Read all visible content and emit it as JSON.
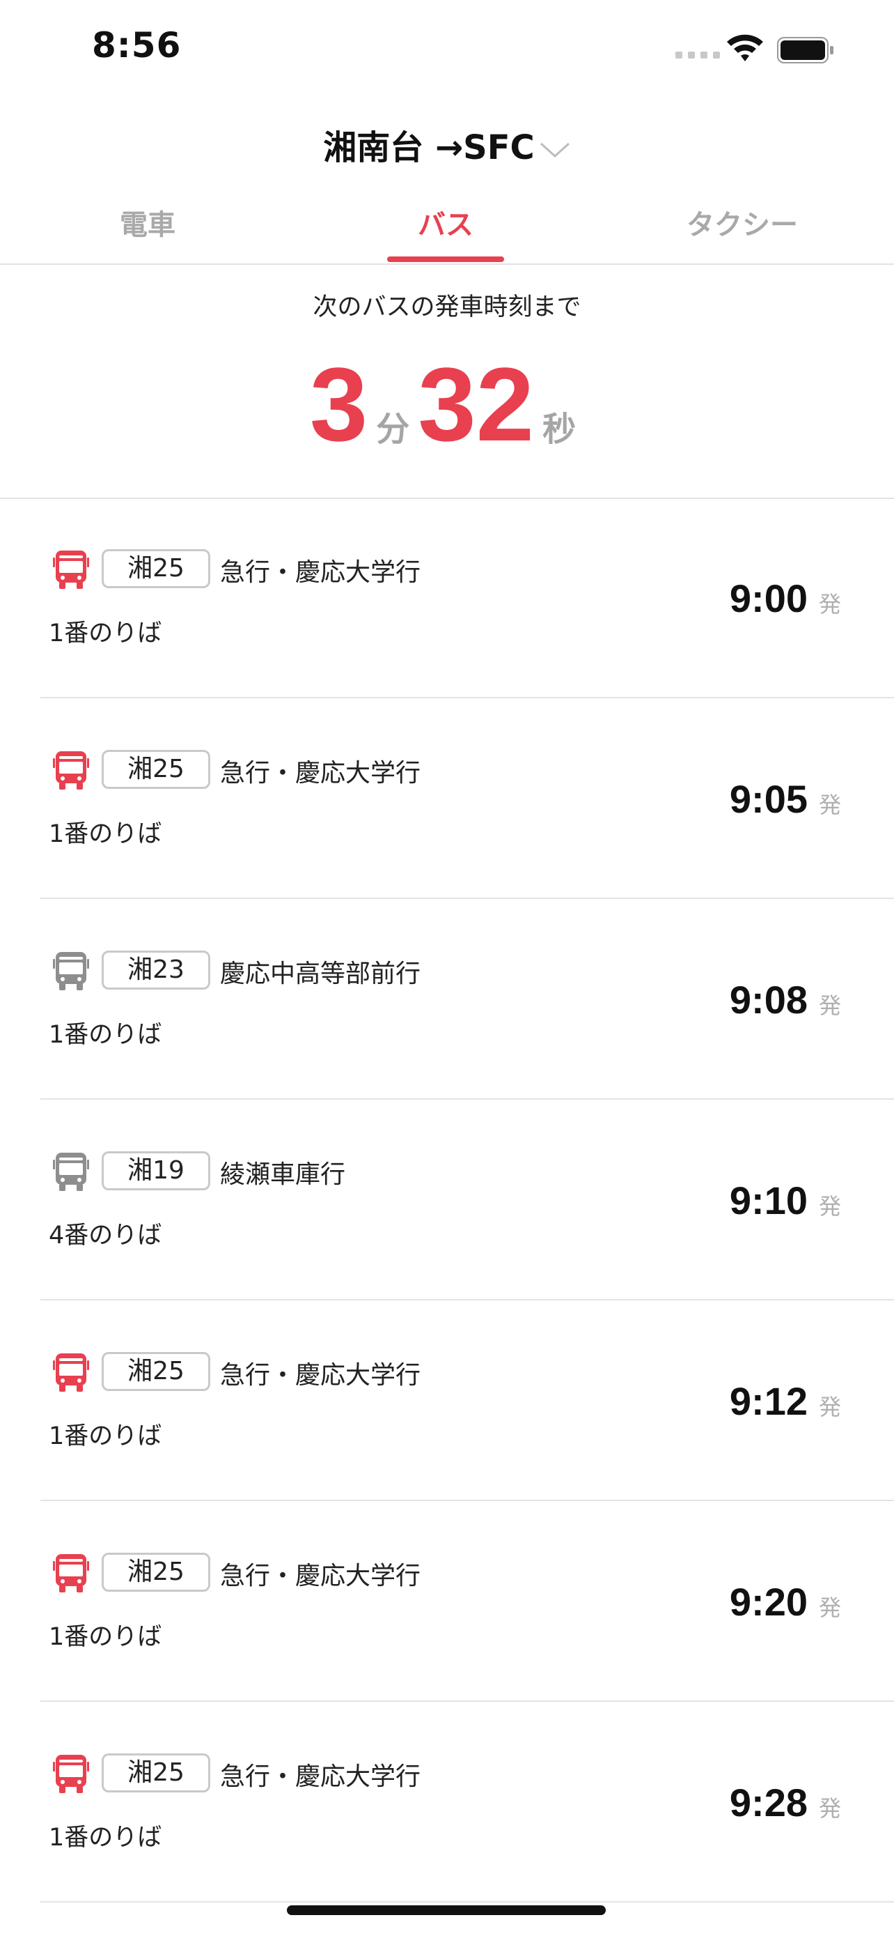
{
  "status_bar": {
    "time": "8:56"
  },
  "header": {
    "route_title": "湘南台 →SFC"
  },
  "tabs": [
    {
      "label": "電車",
      "active": false
    },
    {
      "label": "バス",
      "active": true
    },
    {
      "label": "タクシー",
      "active": false
    }
  ],
  "countdown": {
    "caption": "次のバスの発車時刻まで",
    "minutes": "3",
    "minutes_unit": "分",
    "seconds": "32",
    "seconds_unit": "秒"
  },
  "colors": {
    "accent": "#e8404f",
    "inactive_icon": "#8e8e8e"
  },
  "departures": [
    {
      "route": "湘25",
      "destination": "急行・慶応大学行",
      "platform": "1番のりば",
      "time": "9:00",
      "suffix": "発",
      "icon": "bus-icon-red"
    },
    {
      "route": "湘25",
      "destination": "急行・慶応大学行",
      "platform": "1番のりば",
      "time": "9:05",
      "suffix": "発",
      "icon": "bus-icon-red"
    },
    {
      "route": "湘23",
      "destination": "慶応中高等部前行",
      "platform": "1番のりば",
      "time": "9:08",
      "suffix": "発",
      "icon": "bus-icon-gray"
    },
    {
      "route": "湘19",
      "destination": "綾瀬車庫行",
      "platform": "4番のりば",
      "time": "9:10",
      "suffix": "発",
      "icon": "bus-icon-gray"
    },
    {
      "route": "湘25",
      "destination": "急行・慶応大学行",
      "platform": "1番のりば",
      "time": "9:12",
      "suffix": "発",
      "icon": "bus-icon-red"
    },
    {
      "route": "湘25",
      "destination": "急行・慶応大学行",
      "platform": "1番のりば",
      "time": "9:20",
      "suffix": "発",
      "icon": "bus-icon-red"
    },
    {
      "route": "湘25",
      "destination": "急行・慶応大学行",
      "platform": "1番のりば",
      "time": "9:28",
      "suffix": "発",
      "icon": "bus-icon-red"
    }
  ]
}
